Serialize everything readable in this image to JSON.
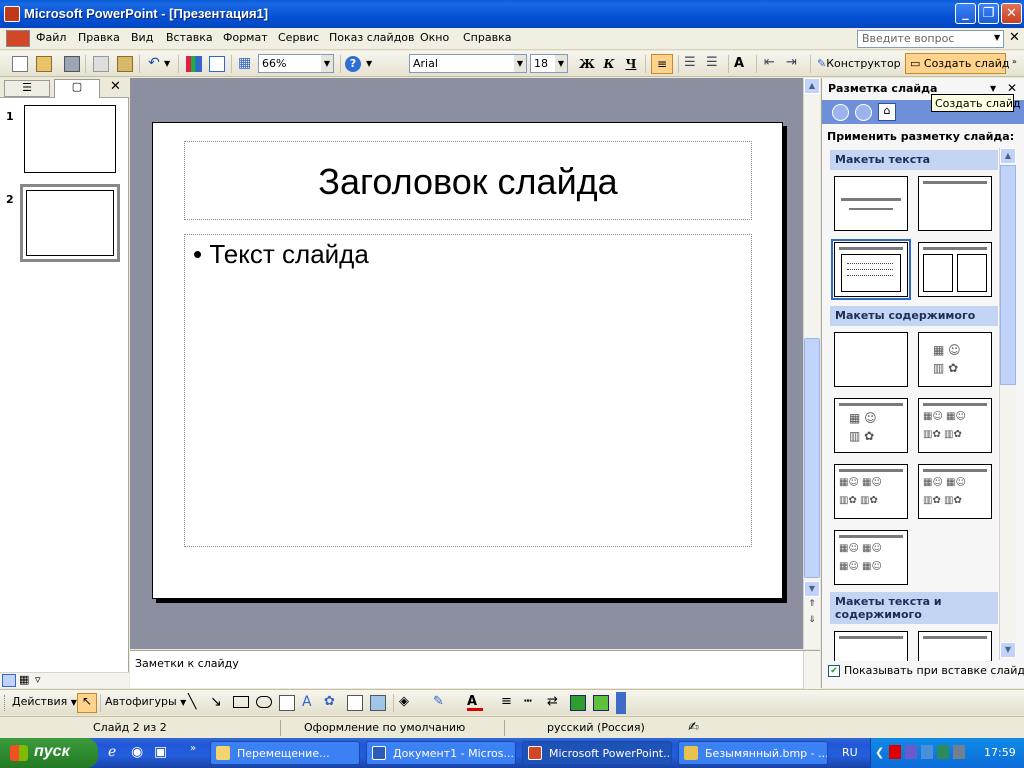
{
  "window": {
    "title": "Microsoft PowerPoint - [Презентация1]"
  },
  "menu": {
    "items": [
      "Файл",
      "Правка",
      "Вид",
      "Вставка",
      "Формат",
      "Сервис",
      "Показ слайдов",
      "Окно",
      "Справка"
    ],
    "ask_placeholder": "Введите вопрос"
  },
  "toolbar": {
    "zoom": "66%",
    "font": "Arial",
    "font_size": "18",
    "bold": "Ж",
    "italic": "К",
    "underline": "Ч",
    "designer_label": "Конструктор",
    "new_slide_label": "Создать слайд"
  },
  "slides_panel": {
    "slides": [
      {
        "number": "1"
      },
      {
        "number": "2"
      }
    ],
    "current_slide": 2
  },
  "slide": {
    "title": "Заголовок слайда",
    "bullet": "•",
    "body": "Текст слайда"
  },
  "notes": {
    "placeholder": "Заметки к слайду"
  },
  "task_pane": {
    "title": "Разметка слайда",
    "tooltip": "Создать слайд",
    "apply_label": "Применить разметку слайда:",
    "sections": [
      "Макеты текста",
      "Макеты содержимого",
      "Макеты текста и содержимого"
    ],
    "show_on_insert": "Показывать при вставке слайдов"
  },
  "draw_toolbar": {
    "actions": "Действия",
    "autoshapes": "Автофигуры"
  },
  "status": {
    "slide_info": "Слайд 2 из 2",
    "design": "Оформление по умолчанию",
    "language": "русский (Россия)"
  },
  "taskbar": {
    "start": "пуск",
    "items": [
      "Перемещение...",
      "Документ1 - Micros...",
      "Microsoft PowerPoint...",
      "Безымянный.bmp - ..."
    ],
    "lang": "RU",
    "time": "17:59"
  },
  "colors": {
    "accent": "#316ac5",
    "title_bar": "#0a5fd8",
    "new_slide_highlight": "#ffd38c",
    "start_button": "#2f8b2f"
  }
}
